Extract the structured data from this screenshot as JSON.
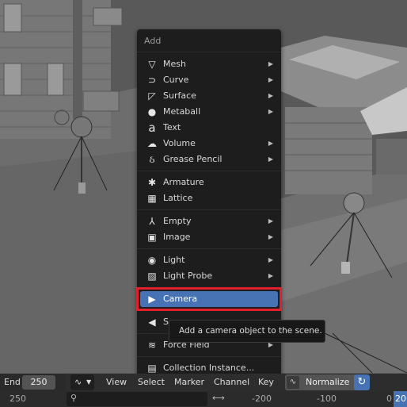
{
  "menu": {
    "title": "Add",
    "items": [
      {
        "label": "Mesh",
        "icon": "mesh-icon",
        "glyph": "▽",
        "submenu": true
      },
      {
        "label": "Curve",
        "icon": "curve-icon",
        "glyph": "⊃",
        "submenu": true
      },
      {
        "label": "Surface",
        "icon": "surface-icon",
        "glyph": "◸",
        "submenu": true
      },
      {
        "label": "Metaball",
        "icon": "metaball-icon",
        "glyph": "●",
        "submenu": true
      },
      {
        "label": "Text",
        "icon": "text-icon",
        "glyph": "a",
        "submenu": false
      },
      {
        "label": "Volume",
        "icon": "volume-icon",
        "glyph": "☁",
        "submenu": true
      },
      {
        "label": "Grease Pencil",
        "icon": "grease-pencil-icon",
        "glyph": "ઠ",
        "submenu": true
      },
      {
        "label": "Armature",
        "icon": "armature-icon",
        "glyph": "✱",
        "submenu": false
      },
      {
        "label": "Lattice",
        "icon": "lattice-icon",
        "glyph": "▦",
        "submenu": false
      },
      {
        "label": "Empty",
        "icon": "empty-icon",
        "glyph": "⅄",
        "submenu": true
      },
      {
        "label": "Image",
        "icon": "image-icon",
        "glyph": "▣",
        "submenu": true
      },
      {
        "label": "Light",
        "icon": "light-icon",
        "glyph": "◉",
        "submenu": true
      },
      {
        "label": "Light Probe",
        "icon": "light-probe-icon",
        "glyph": "▨",
        "submenu": true
      },
      {
        "label": "Camera",
        "icon": "camera-icon",
        "glyph": "▶",
        "submenu": false
      },
      {
        "label": "S",
        "icon": "speaker-icon",
        "glyph": "◀",
        "submenu": false
      },
      {
        "label": "Force Field",
        "icon": "force-field-icon",
        "glyph": "≋",
        "submenu": true
      },
      {
        "label": "Collection Instance...",
        "icon": "collection-instance-icon",
        "glyph": "▤",
        "submenu": false
      }
    ]
  },
  "tooltip": "Add a camera object to the scene.",
  "timeline": {
    "end_label": "End",
    "end_value": "250"
  },
  "header": {
    "view": "View",
    "select": "Select",
    "marker": "Marker",
    "channel": "Channel",
    "key": "Key",
    "normalize": "Normalize"
  },
  "bottom": {
    "frames": [
      "250",
      "-200",
      "-100",
      "0"
    ],
    "current_frame": "20"
  },
  "colors": {
    "accent": "#4772b3",
    "highlight_border": "#e0202c",
    "menu_bg": "#1d1d1d"
  }
}
